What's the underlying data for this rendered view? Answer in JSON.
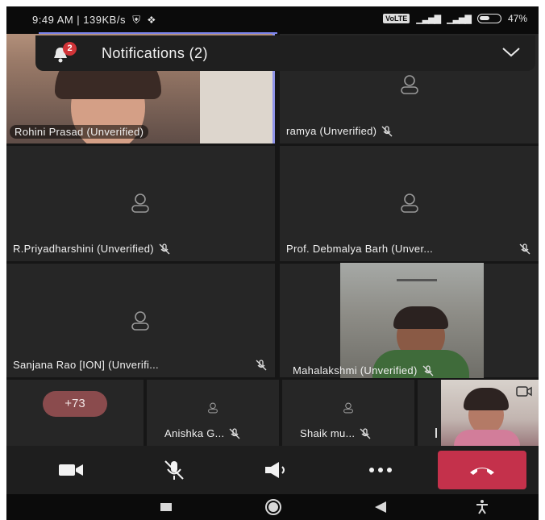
{
  "status_bar": {
    "time_speed": "9:49 AM | 139KB/s",
    "volte_badge": "VoLTE",
    "battery": "47%",
    "icons": [
      "shield-icon",
      "teams-icon",
      "signal-icon",
      "signal-icon",
      "battery-icon"
    ]
  },
  "notifications": {
    "badge_count": "2",
    "title": "Notifications (2)",
    "icon": "bell-icon",
    "chevron": "chevron-down-icon"
  },
  "participants": [
    {
      "name": "Rohini Prasad (Unverified)",
      "video": true,
      "muted": false,
      "active_speaker": true
    },
    {
      "name": "ramya (Unverified)",
      "video": false,
      "muted": true
    },
    {
      "name": "R.Priyadharshini (Unverified)",
      "video": false,
      "muted": true
    },
    {
      "name": "Prof. Debmalya Barh (Unver...",
      "video": false,
      "muted": true
    },
    {
      "name": "Sanjana Rao [ION] (Unverifi...",
      "video": false,
      "muted": true
    },
    {
      "name": "Mahalakshmi (Unverified)",
      "video": true,
      "muted": true
    },
    {
      "name": "Anishka G...",
      "video": false,
      "muted": true
    },
    {
      "name": "Shaik mu...",
      "video": false,
      "muted": true
    }
  ],
  "overflow_count": "+73",
  "controls": {
    "camera": "video-camera-icon",
    "mic": "mic-off-icon",
    "speaker": "speaker-icon",
    "more": "more-icon",
    "hangup": "hang-up-icon"
  },
  "colors": {
    "accent": "#7b83eb",
    "hangup": "#c4314b",
    "notification_badge": "#d13438",
    "tile_bg": "#262626"
  }
}
